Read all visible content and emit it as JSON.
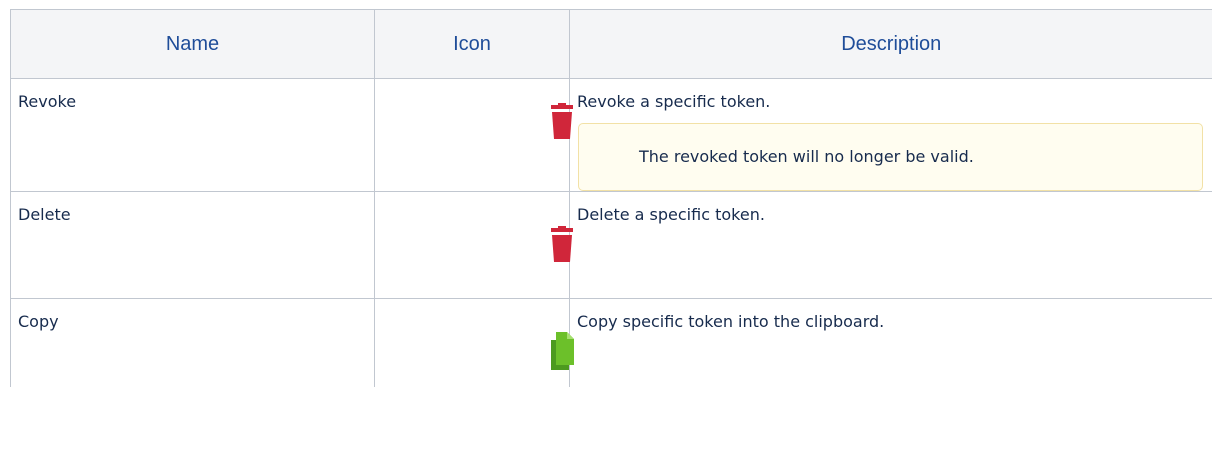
{
  "table": {
    "headers": {
      "name": "Name",
      "icon": "Icon",
      "description": "Description"
    },
    "rows": [
      {
        "name": "Revoke",
        "icon": "trash-icon",
        "icon_color": "#d0263a",
        "description": "Revoke a specific token.",
        "note": "The revoked token will no longer be valid."
      },
      {
        "name": "Delete",
        "icon": "trash-icon",
        "icon_color": "#d0263a",
        "description": "Delete a specific token."
      },
      {
        "name": "Copy",
        "icon": "copy-icon",
        "icon_color": "#6cc02a",
        "description": "Copy specific token into the clipboard."
      }
    ]
  },
  "colors": {
    "header_text": "#1f4d99",
    "header_background": "#f4f5f7",
    "border": "#c1c7d0",
    "note_border": "#f2e1a6",
    "note_background": "#fffdf0"
  }
}
